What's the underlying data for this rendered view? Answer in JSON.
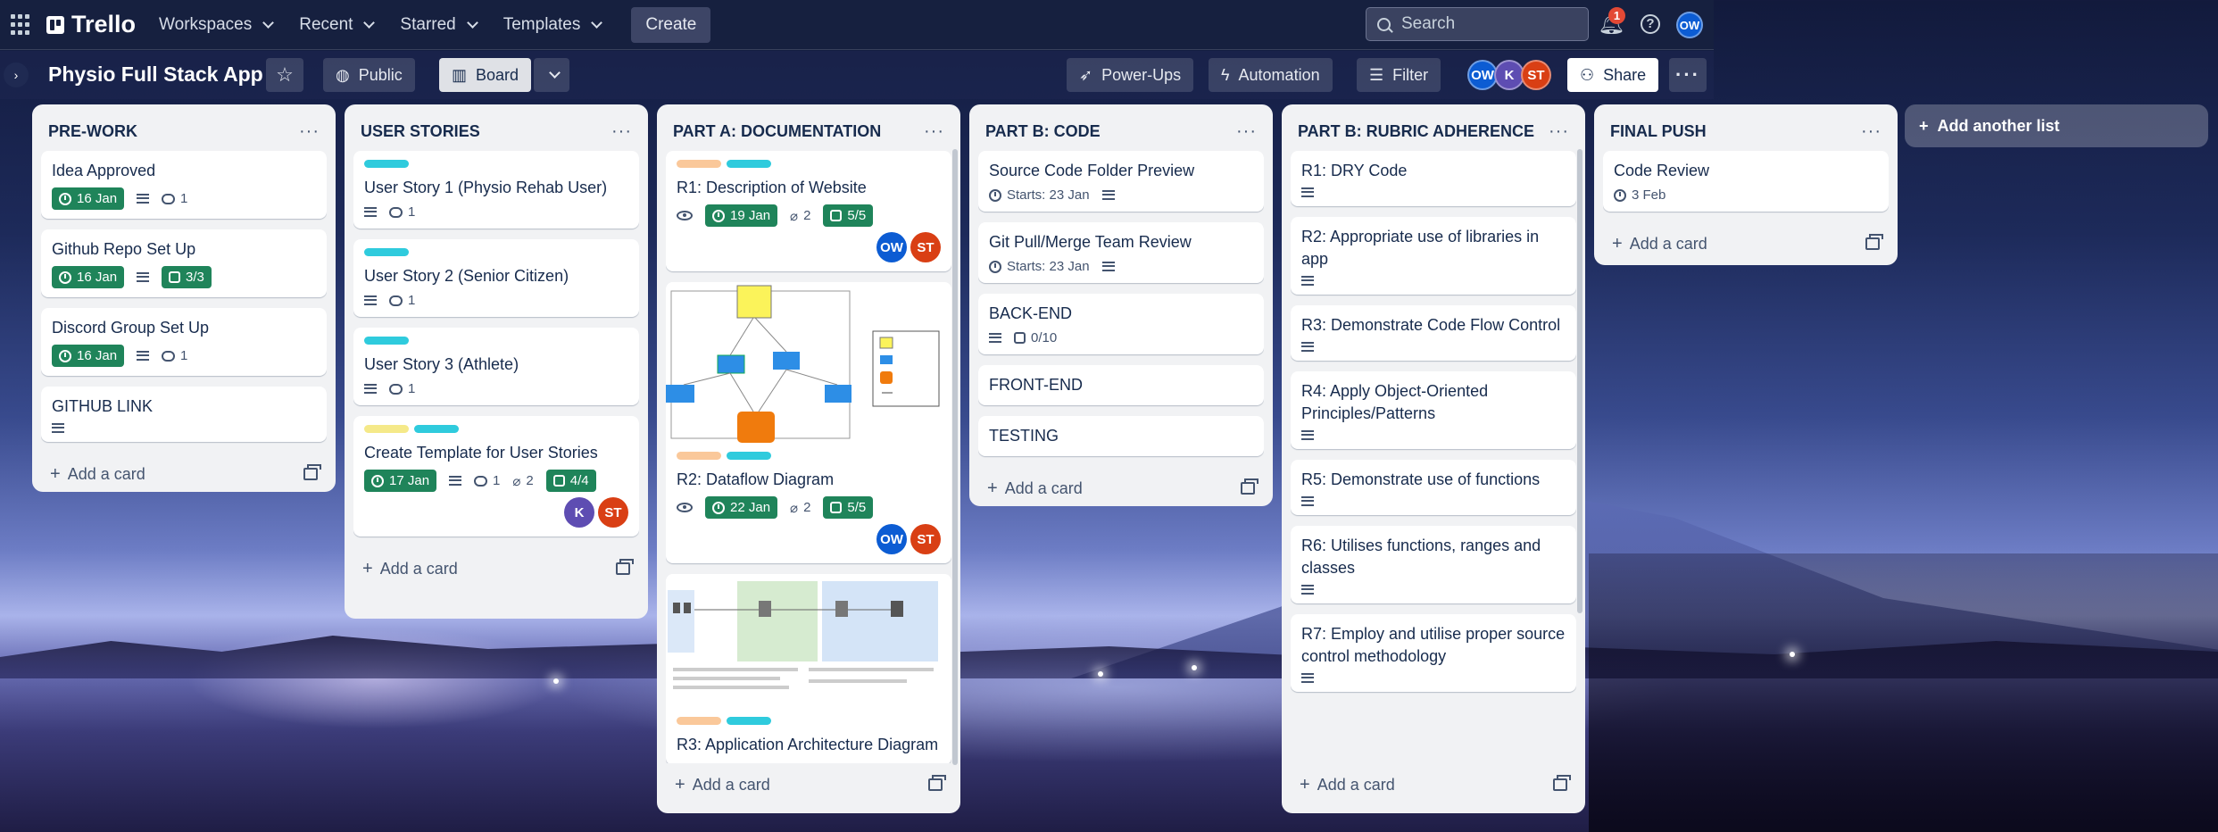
{
  "app": {
    "name": "Trello"
  },
  "nav": {
    "workspaces": "Workspaces",
    "recent": "Recent",
    "starred": "Starred",
    "templates": "Templates",
    "create": "Create",
    "search_placeholder": "Search",
    "notification_count": "1",
    "help": "?",
    "user_initials": "OW"
  },
  "board": {
    "title": "Physio Full Stack App",
    "visibility": "Public",
    "view": "Board",
    "powerups": "Power-Ups",
    "automation": "Automation",
    "filter": "Filter",
    "share": "Share",
    "members": [
      "OW",
      "K",
      "ST"
    ]
  },
  "lists": [
    {
      "title": "PRE-WORK",
      "add_card": "Add a card",
      "cards": [
        {
          "title": "Idea Approved",
          "due": "16 Jan",
          "comments": "1"
        },
        {
          "title": "Github Repo Set Up",
          "due": "16 Jan",
          "checklist": "3/3"
        },
        {
          "title": "Discord Group Set Up",
          "due": "16 Jan",
          "comments": "1"
        },
        {
          "title": "GITHUB LINK"
        }
      ]
    },
    {
      "title": "USER STORIES",
      "add_card": "Add a card",
      "cards": [
        {
          "title": "User Story 1 (Physio Rehab User)",
          "comments": "1"
        },
        {
          "title": "User Story 2 (Senior Citizen)",
          "comments": "1"
        },
        {
          "title": "User Story 3 (Athlete)",
          "comments": "1"
        },
        {
          "title": "Create Template for User Stories",
          "due": "17 Jan",
          "comments": "1",
          "attachments": "2",
          "checklist": "4/4",
          "members": [
            "K",
            "ST"
          ]
        }
      ]
    },
    {
      "title": "PART A: DOCUMENTATION",
      "add_card": "Add a card",
      "cards": [
        {
          "title": "R1: Description of Website",
          "due": "19 Jan",
          "attachments": "2",
          "checklist": "5/5",
          "members": [
            "OW",
            "ST"
          ]
        },
        {
          "title": "R2: Dataflow Diagram",
          "due": "22 Jan",
          "attachments": "2",
          "checklist": "5/5",
          "members": [
            "OW",
            "ST"
          ]
        },
        {
          "title": "R3: Application Architecture Diagram"
        }
      ]
    },
    {
      "title": "PART B: CODE",
      "add_card": "Add a card",
      "cards": [
        {
          "title": "Source Code Folder Preview",
          "starts": "Starts: 23 Jan"
        },
        {
          "title": "Git Pull/Merge Team Review",
          "starts": "Starts: 23 Jan"
        },
        {
          "title": "BACK-END",
          "checklist": "0/10"
        },
        {
          "title": "FRONT-END"
        },
        {
          "title": "TESTING"
        }
      ]
    },
    {
      "title": "PART B: RUBRIC ADHERENCE",
      "add_card": "Add a card",
      "cards": [
        {
          "title": "R1: DRY Code"
        },
        {
          "title": "R2: Appropriate use of libraries in app"
        },
        {
          "title": "R3: Demonstrate Code Flow Control"
        },
        {
          "title": "R4: Apply Object-Oriented Principles/Patterns"
        },
        {
          "title": "R5: Demonstrate use of functions"
        },
        {
          "title": "R6: Utilises functions, ranges and classes"
        },
        {
          "title": "R7: Employ and utilise proper source control methodology"
        }
      ]
    },
    {
      "title": "FINAL PUSH",
      "add_card": "Add a card",
      "cards": [
        {
          "title": "Code Review",
          "date": "3 Feb"
        }
      ]
    }
  ],
  "add_list": "Add another list",
  "colors": {
    "due_green": "#1f845a",
    "label_orange": "#fac89a",
    "label_cyan": "#2fcbdd",
    "label_yellow": "#f5e989",
    "member_ow": "#0c5cd3",
    "member_k": "#5e4db2",
    "member_st": "#d93f14"
  }
}
